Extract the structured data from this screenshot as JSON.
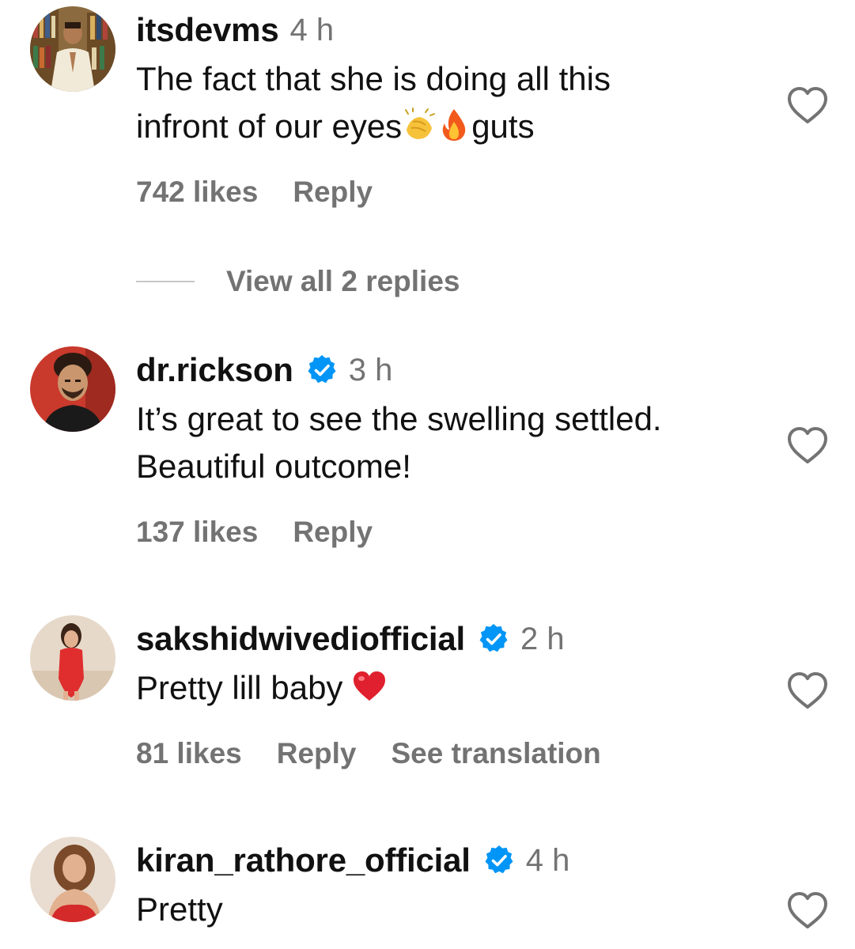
{
  "comments": [
    {
      "username": "itsdevms",
      "verified": false,
      "time": "4 h",
      "text_part1": "The fact that she is doing all this\ninfront of our eyes",
      "emojis": [
        "clapping-hands-emoji",
        "fire-emoji"
      ],
      "text_part2": "guts",
      "likes": "742 likes",
      "reply": "Reply",
      "view_replies": "View all 2 replies"
    },
    {
      "username": "dr.rickson",
      "verified": true,
      "time": "3 h",
      "text": "It’s great to see the swelling settled.\nBeautiful outcome!",
      "likes": "137 likes",
      "reply": "Reply"
    },
    {
      "username": "sakshidwivediofficial",
      "verified": true,
      "time": "2 h",
      "text": "Pretty lill baby ",
      "emojis": [
        "red-heart-emoji"
      ],
      "likes": "81 likes",
      "reply": "Reply",
      "see_translation": "See translation"
    },
    {
      "username": "kiran_rathore_official",
      "verified": true,
      "time": "4 h",
      "text": "Pretty"
    }
  ],
  "colors": {
    "text": "#111111",
    "secondary": "#737373",
    "verified_blue": "#0095f6",
    "divider": "#c7c7c7"
  },
  "icons": {
    "like": "heart-outline-icon",
    "verified": "verified-badge-icon"
  }
}
